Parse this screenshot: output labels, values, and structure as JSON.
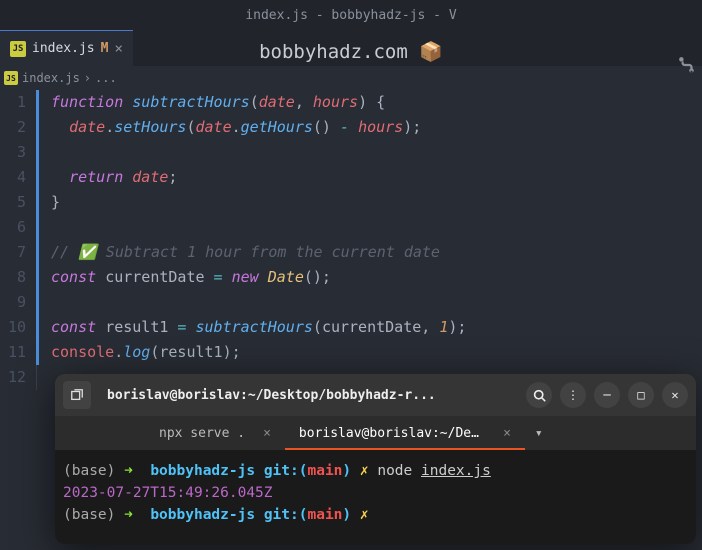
{
  "window": {
    "title": "index.js - bobbyhadz-js - V"
  },
  "watermark": "bobbyhadz.com 📦",
  "tab": {
    "icon": "JS",
    "name": "index.js",
    "modified": "M",
    "close": "×"
  },
  "breadcrumb": {
    "file": "index.js",
    "sep": "›",
    "rest": "..."
  },
  "lines": [
    "1",
    "2",
    "3",
    "4",
    "5",
    "6",
    "7",
    "8",
    "9",
    "10",
    "11",
    "12"
  ],
  "code": {
    "l1": {
      "kw": "function",
      "fn": "subtractHours",
      "p1": "date",
      "p2": "hours",
      "open": "(",
      "comma": ", ",
      "close": ")",
      "brace": "{"
    },
    "l2": {
      "obj": "date",
      "dot": ".",
      "m1": "setHours",
      "o": "(",
      "obj2": "date",
      "m2": "getHours",
      "oc": "()",
      "op": " - ",
      "p": "hours",
      "c": ");"
    },
    "l4": {
      "kw": "return",
      "v": "date",
      "semi": ";"
    },
    "l5": {
      "brace": "}"
    },
    "l7": {
      "c": "// ✅ Subtract 1 hour from the current date"
    },
    "l8": {
      "kw": "const",
      "v": "currentDate",
      "eq": " = ",
      "new": "new",
      "cls": "Date",
      "call": "();"
    },
    "l10": {
      "kw": "const",
      "v": "result1",
      "eq": " = ",
      "fn": "subtractHours",
      "o": "(",
      "a1": "currentDate",
      "comma": ", ",
      "a2": "1",
      "c": ");"
    },
    "l11": {
      "obj": "console",
      "dot": ".",
      "m": "log",
      "o": "(",
      "a": "result1",
      "c": ");"
    }
  },
  "terminal": {
    "title": "borislav@borislav:~/Desktop/bobbyhadz-r...",
    "tabs": {
      "t1": {
        "label": "npx serve .",
        "close": "×"
      },
      "t2": {
        "label": "borislav@borislav:~/Desktop/b...",
        "close": "×"
      }
    },
    "lines": {
      "p1": {
        "base": "(base)",
        "arrow": "➜",
        "cwd": "bobbyhadz-js",
        "git": "git:(",
        "branch": "main",
        "gitc": ")",
        "x": "✗",
        "cmd": "node ",
        "file": "index.js"
      },
      "out": "2023-07-27T15:49:26.045Z",
      "p2": {
        "base": "(base)",
        "arrow": "➜",
        "cwd": "bobbyhadz-js",
        "git": "git:(",
        "branch": "main",
        "gitc": ")",
        "x": "✗"
      }
    }
  }
}
